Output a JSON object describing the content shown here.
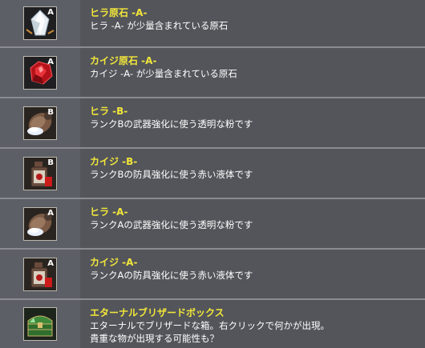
{
  "items": [
    {
      "name": "ヒラ原石 -A-",
      "desc": [
        "ヒラ -A- が少量含まれている原石"
      ],
      "icon": "white-crystal-icon",
      "grade": "A"
    },
    {
      "name": "カイジ原石 -A-",
      "desc": [
        "カイジ -A- が少量含まれている原石"
      ],
      "icon": "red-crystal-icon",
      "grade": "A"
    },
    {
      "name": "ヒラ -B-",
      "desc": [
        "ランクBの武器強化に使う透明な粉です"
      ],
      "icon": "powder-sack-icon",
      "grade": "B"
    },
    {
      "name": "カイジ -B-",
      "desc": [
        "ランクBの防具強化に使う赤い液体です"
      ],
      "icon": "red-potion-icon",
      "grade": "B"
    },
    {
      "name": "ヒラ -A-",
      "desc": [
        "ランクAの武器強化に使う透明な粉です"
      ],
      "icon": "powder-sack-icon",
      "grade": "A"
    },
    {
      "name": "カイジ -A-",
      "desc": [
        "ランクAの防具強化に使う赤い液体です"
      ],
      "icon": "red-potion-icon",
      "grade": "A"
    },
    {
      "name": "エターナルブリザードボックス",
      "desc": [
        "エターナルでブリザードな箱。右クリックで何かが出現。",
        "貴重な物が出現する可能性も？"
      ],
      "icon": "green-treasure-chest-icon",
      "grade": ""
    }
  ]
}
